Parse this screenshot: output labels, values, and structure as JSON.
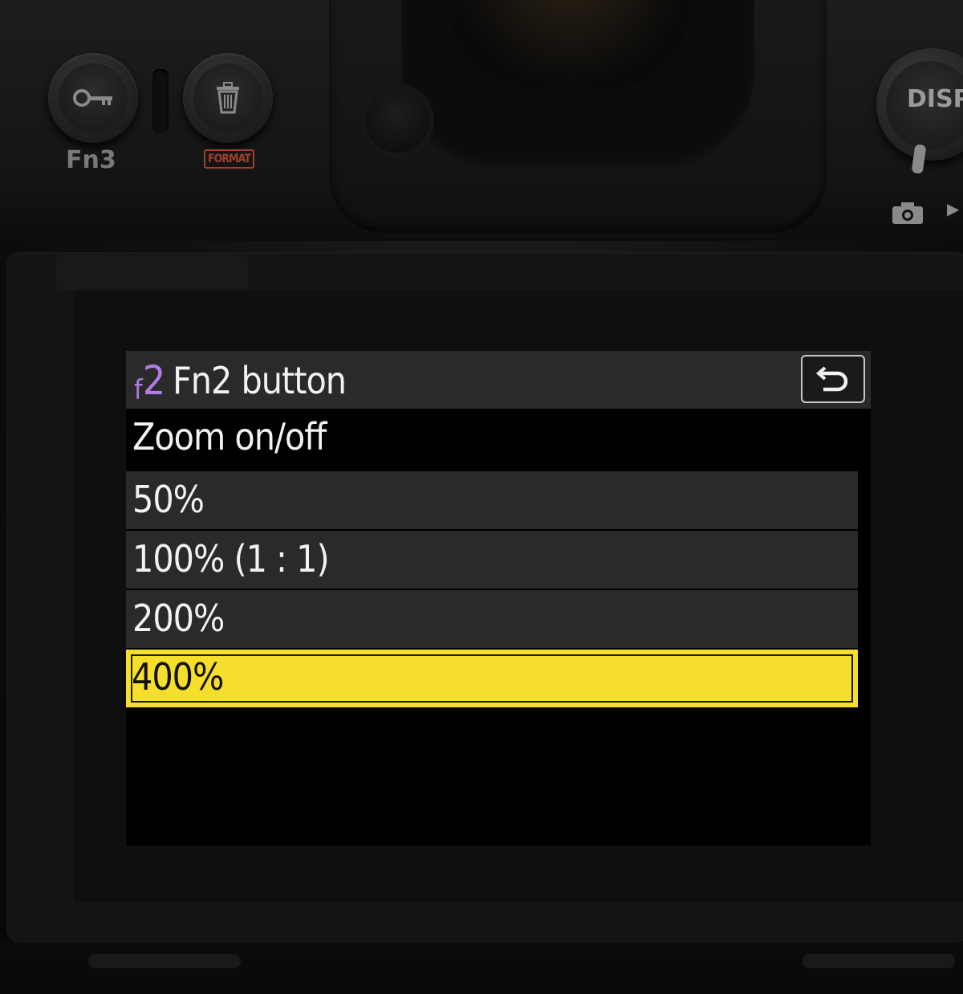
{
  "camera": {
    "fn3_label": "Fn3",
    "format_label": "FORMAT",
    "disp_label": "DISP",
    "icons": [
      "key-icon",
      "trash-icon",
      "camera-icon",
      "playback-icon"
    ]
  },
  "menu": {
    "code_letter": "f",
    "code_digit": "2",
    "title": "Fn2 button",
    "back_icon": "return-icon",
    "subtitle": "Zoom on/off",
    "options": [
      {
        "label": "50%",
        "selected": false
      },
      {
        "label": "100% (1 : 1)",
        "selected": false
      },
      {
        "label": "200%",
        "selected": false
      },
      {
        "label": "400%",
        "selected": true
      }
    ]
  },
  "colors": {
    "highlight": "#f6df2c",
    "menu_code": "#b07ce6",
    "row_bg": "#2a2a2a",
    "format_red": "#a0402c"
  }
}
